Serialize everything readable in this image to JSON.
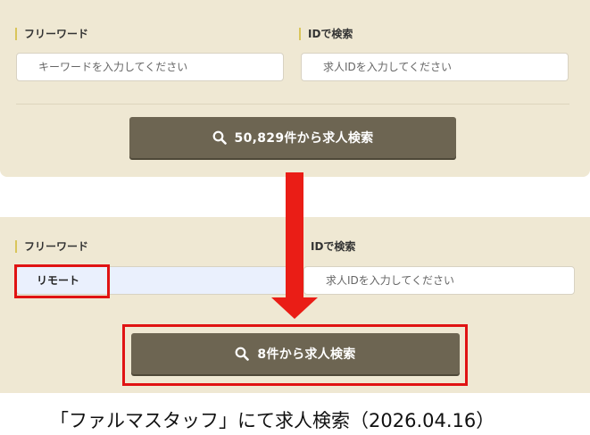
{
  "top": {
    "free_word_label": "フリーワード",
    "id_label": "IDで検索",
    "free_word_placeholder": "キーワードを入力してください",
    "id_placeholder": "求人IDを入力してください",
    "search_button": "50,829件から求人検索"
  },
  "bottom": {
    "free_word_label": "フリーワード",
    "id_label": "IDで検索",
    "free_word_value": "リモート",
    "id_placeholder": "求人IDを入力してください",
    "search_button": "8件から求人検索"
  },
  "caption": "「ファルマスタッフ」にて求人検索（2026.04.16）",
  "colors": {
    "panel_bg": "#efe8d3",
    "button_bg": "#6d6552",
    "highlight_red": "#e01313",
    "label_bar": "#d9c55b"
  }
}
